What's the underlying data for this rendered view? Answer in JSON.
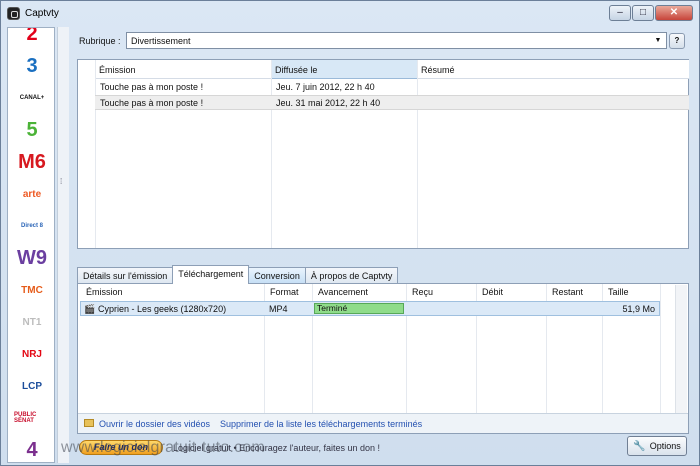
{
  "window": {
    "title": "Captvty"
  },
  "channels": [
    {
      "name": "channel-france2",
      "label": "2",
      "color": "#e2001a"
    },
    {
      "name": "channel-france3",
      "label": "3",
      "color": "#1a6fc0"
    },
    {
      "name": "channel-canalplus",
      "label": "CANAL+",
      "color": "#111111"
    },
    {
      "name": "channel-france5",
      "label": "5",
      "color": "#4bb337"
    },
    {
      "name": "channel-m6",
      "label": "M6",
      "color": "#d71920"
    },
    {
      "name": "channel-arte",
      "label": "arte",
      "color": "#ee5a24"
    },
    {
      "name": "channel-direct8",
      "label": "Direct 8",
      "color": "#2b65b7"
    },
    {
      "name": "channel-w9",
      "label": "W9",
      "color": "#6b3fa0"
    },
    {
      "name": "channel-tmc",
      "label": "TMC",
      "color": "#e65c1a"
    },
    {
      "name": "channel-nt1",
      "label": "NT1",
      "color": "#bdbdbd"
    },
    {
      "name": "channel-nrj12",
      "label": "NRJ",
      "color": "#e30613"
    },
    {
      "name": "channel-lcp",
      "label": "LCP",
      "color": "#1b4d9b"
    },
    {
      "name": "channel-publicsenat",
      "label": "PUBLIC SÉNAT",
      "color": "#c8102e"
    },
    {
      "name": "channel-france4",
      "label": "4",
      "color": "#7b2f8e"
    }
  ],
  "rubrique": {
    "label": "Rubrique :",
    "value": "Divertissement"
  },
  "emissions": {
    "headers": [
      "Émission",
      "Diffusée le",
      "Résumé"
    ],
    "rows": [
      {
        "emission": "Touche pas à mon poste !",
        "date": "Jeu. 7 juin 2012, 22 h 40"
      },
      {
        "emission": "Touche pas à mon poste !",
        "date": "Jeu. 31 mai 2012, 22 h 40"
      }
    ]
  },
  "tabs": [
    "Détails sur l'émission",
    "Téléchargement",
    "Conversion",
    "À propos de Captvty"
  ],
  "downloads": {
    "headers": [
      "Émission",
      "Format",
      "Avancement",
      "Reçu",
      "Débit",
      "Restant",
      "Taille"
    ],
    "rows": [
      {
        "emission": "Cyprien - Les geeks (1280x720)",
        "format": "MP4",
        "status": "Terminé",
        "progress": 1.0,
        "recu": "",
        "debit": "",
        "restant": "",
        "taille": "51,9 Mo"
      }
    ],
    "footer_links": [
      "Ouvrir le dossier des vidéos",
      "Supprimer de la liste les téléchargements terminés"
    ]
  },
  "bottom": {
    "donate": "Faire un don",
    "gratuit": "Logiciel gratuit • Encouragez l'auteur, faites un don !",
    "watermark": "www.logicielgratuit-tuto.com",
    "options": "Options"
  }
}
